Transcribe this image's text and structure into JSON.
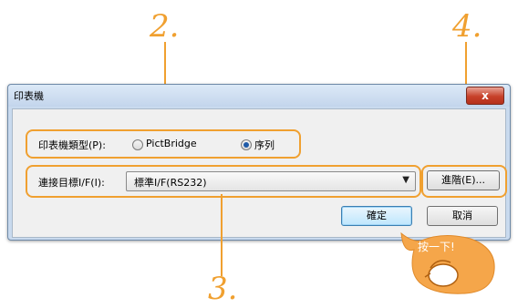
{
  "callouts": {
    "c2": "2.",
    "c3": "3.",
    "c4": "4."
  },
  "dialog": {
    "title": "印表機",
    "close_glyph": "x",
    "printer_type_label": "印表機類型(P):",
    "radio_pictbridge": {
      "label": "PictBridge",
      "checked": false
    },
    "radio_serial": {
      "label": "序列",
      "checked": true
    },
    "target_if_label": "連接目標I/F(I):",
    "target_if_value": "標準I/F(RS232)",
    "advanced_button": "進階(E)...",
    "ok_button": "確定",
    "cancel_button": "取消"
  },
  "hint": "按一下!",
  "colors": {
    "accent": "#f0a030",
    "hand_bubble": "#f5a64a"
  }
}
